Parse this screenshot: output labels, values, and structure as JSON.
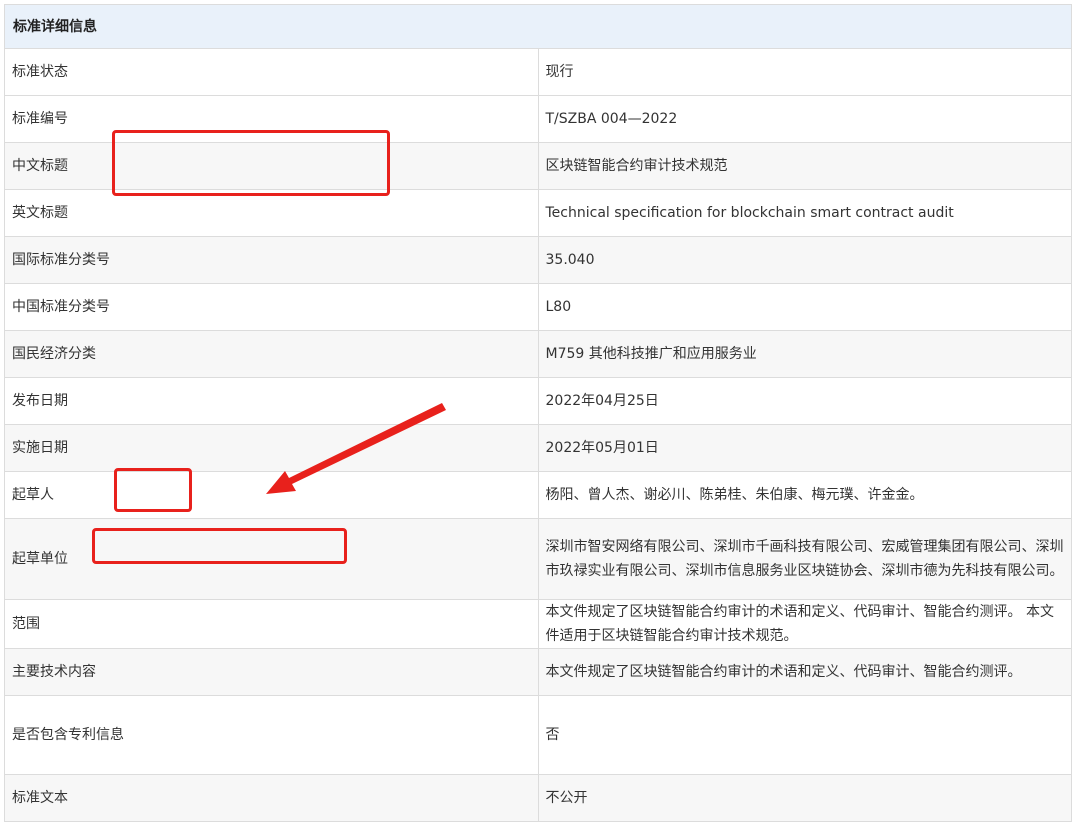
{
  "table": {
    "header": "标准详细信息",
    "rows": [
      {
        "label": "标准状态",
        "value": "现行"
      },
      {
        "label": "标准编号",
        "value": "T/SZBA 004—2022"
      },
      {
        "label": "中文标题",
        "value": "区块链智能合约审计技术规范"
      },
      {
        "label": "英文标题",
        "value": "Technical specification for blockchain smart contract audit"
      },
      {
        "label": "国际标准分类号",
        "value": "35.040"
      },
      {
        "label": "中国标准分类号",
        "value": "L80"
      },
      {
        "label": "国民经济分类",
        "value": "M759 其他科技推广和应用服务业"
      },
      {
        "label": "发布日期",
        "value": "2022年04月25日"
      },
      {
        "label": "实施日期",
        "value": "2022年05月01日"
      },
      {
        "label": "起草人",
        "value": "杨阳、曾人杰、谢必川、陈弟桂、朱伯康、梅元璞、许金金。"
      },
      {
        "label": "起草单位",
        "value": "深圳市智安网络有限公司、深圳市千画科技有限公司、宏威管理集团有限公司、深圳市玖禄实业有限公司、深圳市信息服务业区块链协会、深圳市德为先科技有限公司。"
      },
      {
        "label": "范围",
        "value": "本文件规定了区块链智能合约审计的术语和定义、代码审计、智能合约测评。 本文件适用于区块链智能合约审计技术规范。"
      },
      {
        "label": "主要技术内容",
        "value": "本文件规定了区块链智能合约审计的术语和定义、代码审计、智能合约测评。"
      },
      {
        "label": "是否包含专利信息",
        "value": "否"
      },
      {
        "label": "标准文本",
        "value": "不公开"
      }
    ]
  },
  "annotations": {
    "color": "#e8211c"
  }
}
